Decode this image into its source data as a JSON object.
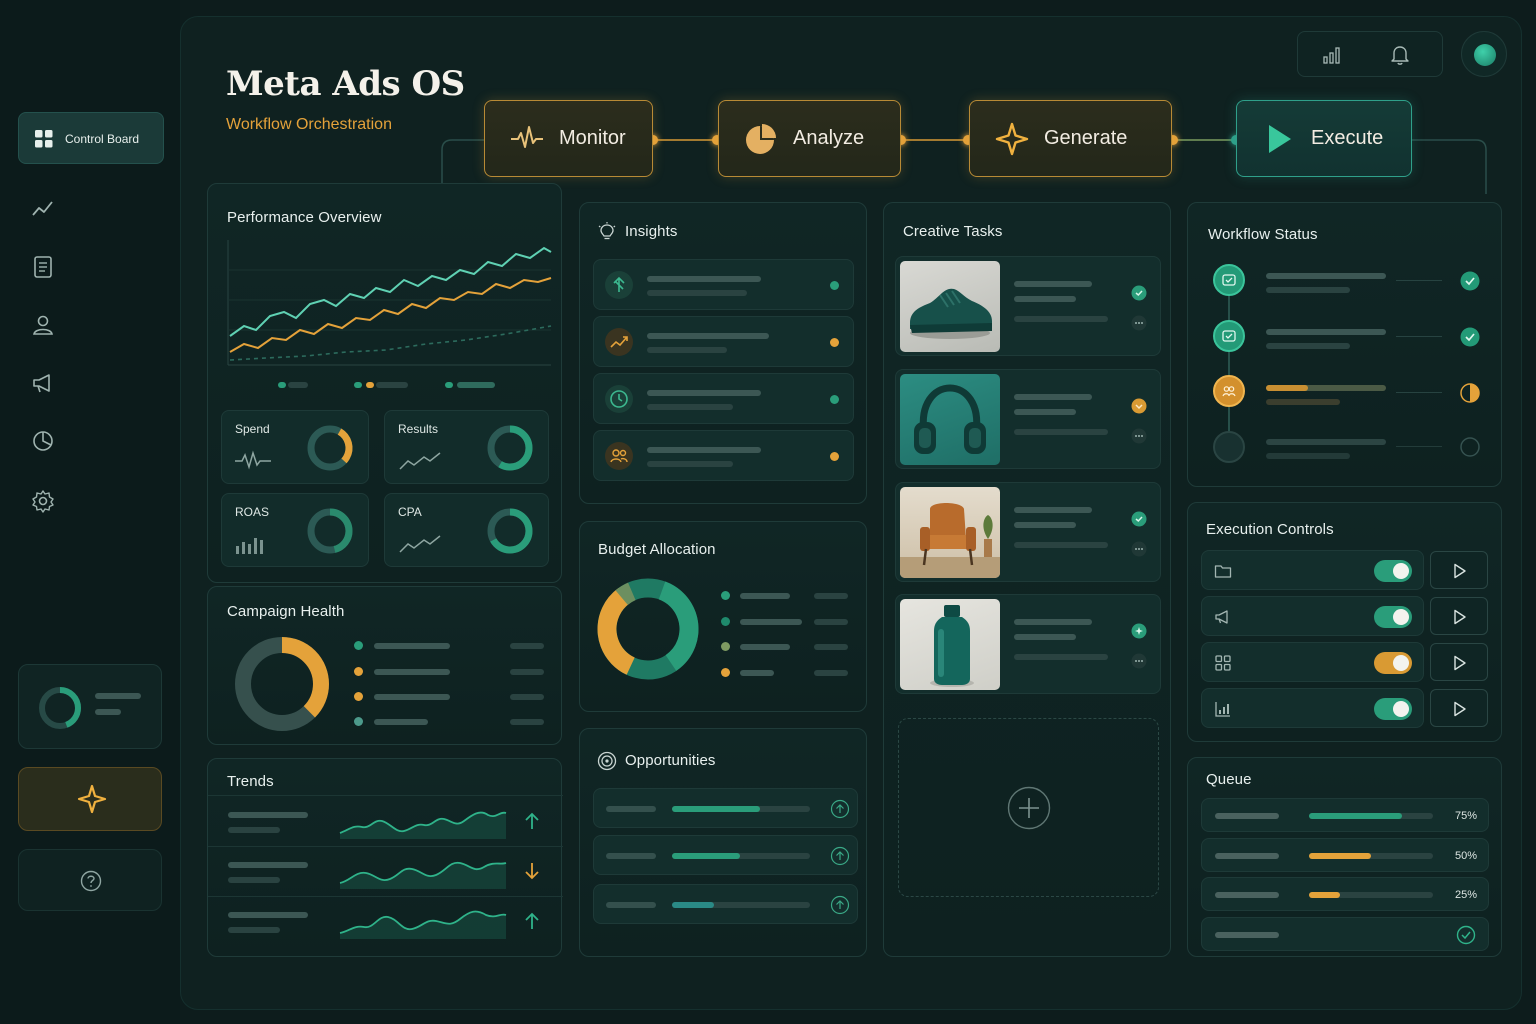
{
  "app": {
    "title": "Meta Ads OS",
    "subtitle": "Workflow Orchestration"
  },
  "sidebar": {
    "items": [
      {
        "label": "Control Board",
        "icon": "grid-icon",
        "active": true
      },
      {
        "label": "",
        "icon": "trend-line-icon"
      },
      {
        "label": "",
        "icon": "document-icon"
      },
      {
        "label": "",
        "icon": "users-icon"
      },
      {
        "label": "",
        "icon": "megaphone-icon"
      },
      {
        "label": "",
        "icon": "pie-chart-icon"
      },
      {
        "label": "",
        "icon": "gear-icon"
      }
    ],
    "bottom": [
      "progress-card",
      "sparkle-icon",
      "help-icon"
    ]
  },
  "topbar": {
    "icons": [
      "signal-bars-icon",
      "bell-icon",
      "avatar"
    ]
  },
  "workflow": {
    "steps": [
      {
        "label": "Monitor",
        "icon": "pulse-icon",
        "state": "gold"
      },
      {
        "label": "Analyze",
        "icon": "pie-chart-icon",
        "state": "gold"
      },
      {
        "label": "Generate",
        "icon": "sparkle-icon",
        "state": "gold"
      },
      {
        "label": "Execute",
        "icon": "play-icon",
        "state": "teal"
      }
    ]
  },
  "performance": {
    "title": "Performance Overview",
    "metrics": [
      {
        "label": "Spend",
        "icon": "pulse-icon"
      },
      {
        "label": "Results",
        "icon": "trend-line-icon"
      },
      {
        "label": "ROAS",
        "icon": "bar-chart-icon"
      },
      {
        "label": "CPA",
        "icon": "trend-line-icon"
      }
    ]
  },
  "campaign_health": {
    "title": "Campaign Health"
  },
  "trends": {
    "title": "Trends",
    "rows": [
      {
        "direction": "up",
        "color": "#2a9d7a"
      },
      {
        "direction": "down",
        "color": "#e4a23a"
      },
      {
        "direction": "up",
        "color": "#2a9d7a"
      }
    ]
  },
  "insights": {
    "title": "Insights",
    "rows": [
      {
        "icon": "arrow-up-icon",
        "status": "green"
      },
      {
        "icon": "chart-up-icon",
        "status": "orange"
      },
      {
        "icon": "clock-icon",
        "status": "green"
      },
      {
        "icon": "users-icon",
        "status": "orange"
      }
    ]
  },
  "budget": {
    "title": "Budget Allocation"
  },
  "opportunities": {
    "title": "Opportunities"
  },
  "creative_tasks": {
    "title": "Creative Tasks",
    "items": [
      {
        "image": "sneaker",
        "status": "green"
      },
      {
        "image": "headphones",
        "status": "orange"
      },
      {
        "image": "armchair",
        "status": "green"
      },
      {
        "image": "bottle",
        "status": "green"
      }
    ]
  },
  "workflow_status": {
    "title": "Workflow Status",
    "steps": [
      {
        "state": "done"
      },
      {
        "state": "done"
      },
      {
        "state": "in-progress"
      },
      {
        "state": "pending"
      }
    ]
  },
  "execution_controls": {
    "title": "Execution Controls",
    "rows": [
      {
        "icon": "folder-icon",
        "toggle": "on",
        "color": "#2a9d7a"
      },
      {
        "icon": "megaphone-icon",
        "toggle": "on",
        "color": "#2a9d7a"
      },
      {
        "icon": "grid-icon",
        "toggle": "on",
        "color": "#d99a33"
      },
      {
        "icon": "bar-chart-icon",
        "toggle": "on",
        "color": "#2a9d7a"
      }
    ]
  },
  "queue": {
    "title": "Queue",
    "items": [
      {
        "progress": 0.75,
        "label": "75%",
        "color": "#2a9d7a"
      },
      {
        "progress": 0.5,
        "label": "50%",
        "color": "#e4a23a"
      },
      {
        "progress": 0.25,
        "label": "25%",
        "color": "#e4a23a"
      },
      {
        "progress": null,
        "label": "",
        "status": "done"
      }
    ]
  },
  "colors": {
    "accent_green": "#2a9d7a",
    "accent_gold": "#e4a23a",
    "background": "#0d1c1c"
  }
}
